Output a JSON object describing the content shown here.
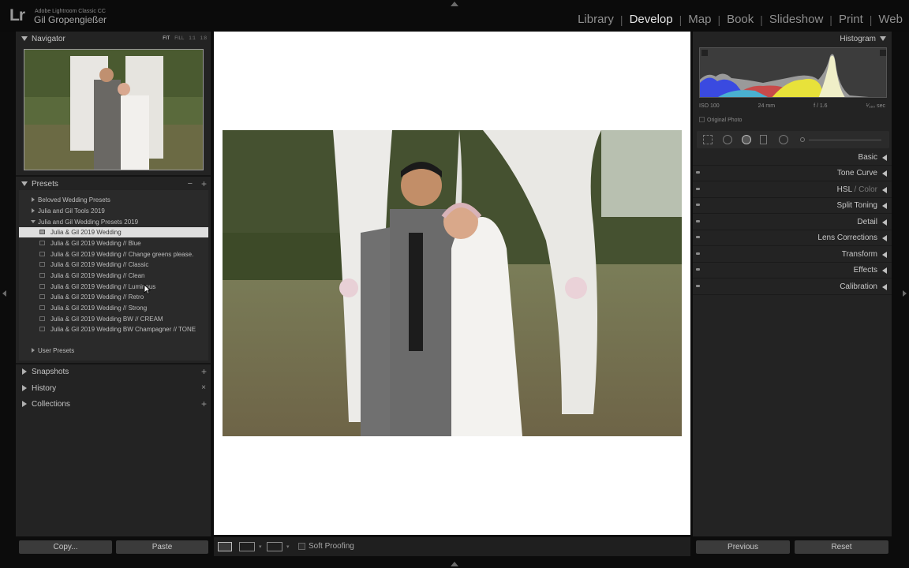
{
  "app": {
    "logo": "Lr",
    "product": "Adobe Lightroom Classic CC",
    "user": "Gil Gropengießer"
  },
  "modules": [
    "Library",
    "Develop",
    "Map",
    "Book",
    "Slideshow",
    "Print",
    "Web"
  ],
  "active_module": "Develop",
  "navigator": {
    "title": "Navigator",
    "options": [
      "FIT",
      "FILL",
      "1:1",
      "1:8"
    ],
    "selected_option": "FIT"
  },
  "presets": {
    "title": "Presets",
    "add_symbol": "+",
    "remove_symbol": "−",
    "groups": [
      {
        "label": "Beloved Wedding Presets",
        "expanded": false
      },
      {
        "label": "Julia and Gil Tools 2019",
        "expanded": false
      },
      {
        "label": "Julia and Gil Wedding Presets 2019",
        "expanded": true
      }
    ],
    "items": [
      {
        "label": "Julia & Gil 2019 Wedding",
        "selected": true
      },
      {
        "label": "Julia & Gil 2019 Wedding // Blue",
        "selected": false
      },
      {
        "label": "Julia & Gil 2019 Wedding // Change greens please.",
        "selected": false
      },
      {
        "label": "Julia & Gil 2019 Wedding // Classic",
        "selected": false
      },
      {
        "label": "Julia & Gil 2019 Wedding // Clean",
        "selected": false
      },
      {
        "label": "Julia & Gil 2019 Wedding // Luminous",
        "selected": false
      },
      {
        "label": "Julia & Gil 2019 Wedding // Retro",
        "selected": false
      },
      {
        "label": "Julia & Gil 2019 Wedding // Strong",
        "selected": false
      },
      {
        "label": "Julia & Gil 2019 Wedding BW // CREAM",
        "selected": false
      },
      {
        "label": "Julia & Gil 2019 Wedding BW Champagner // TONE",
        "selected": false
      }
    ],
    "user_group": "User Presets"
  },
  "left_sections": [
    {
      "label": "Snapshots",
      "action": "+"
    },
    {
      "label": "History",
      "action": "×"
    },
    {
      "label": "Collections",
      "action": "+"
    }
  ],
  "left_buttons": {
    "copy": "Copy...",
    "paste": "Paste"
  },
  "toolbar": {
    "soft_proofing": "Soft Proofing"
  },
  "histogram": {
    "title": "Histogram",
    "iso": "ISO 100",
    "focal": "24 mm",
    "aperture": "f / 1.6",
    "shutter": "¹⁄₁₆₀ sec",
    "original_photo": "Original Photo"
  },
  "right_sections": [
    {
      "label": "Basic"
    },
    {
      "label": "Tone Curve"
    },
    {
      "label": "HSL",
      "suffix": " / Color"
    },
    {
      "label": "Split Toning"
    },
    {
      "label": "Detail"
    },
    {
      "label": "Lens Corrections"
    },
    {
      "label": "Transform"
    },
    {
      "label": "Effects"
    },
    {
      "label": "Calibration"
    }
  ],
  "right_buttons": {
    "previous": "Previous",
    "reset": "Reset"
  }
}
